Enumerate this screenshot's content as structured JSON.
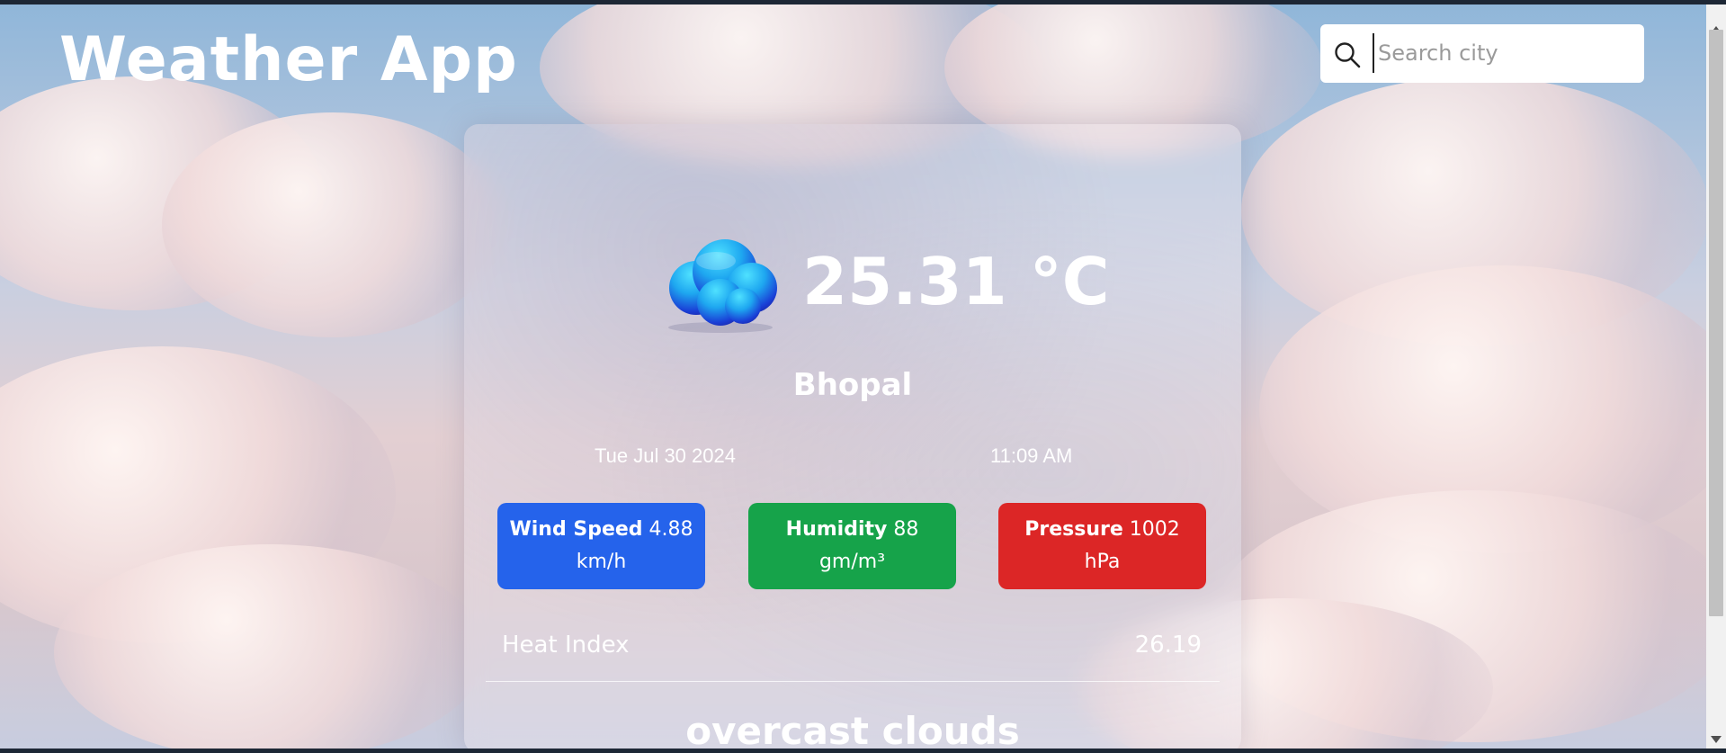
{
  "app": {
    "title": "Weather App"
  },
  "search": {
    "placeholder": "Search city",
    "value": ""
  },
  "weather": {
    "icon": "cloud-icon",
    "temperature": "25.31 °C",
    "city": "Bhopal",
    "date": "Tue Jul 30 2024",
    "time": "11:09 AM",
    "description": "overcast clouds"
  },
  "stats": {
    "wind": {
      "label": "Wind Speed",
      "value": "4.88",
      "unit": "km/h",
      "color": "#2563eb"
    },
    "humidity": {
      "label": "Humidity",
      "value": "88",
      "unit": "gm/m³",
      "color": "#16a34a"
    },
    "pressure": {
      "label": "Pressure",
      "value": "1002",
      "unit": "hPa",
      "color": "#dc2626"
    }
  },
  "heat_index": {
    "label": "Heat Index",
    "value": "26.19"
  }
}
